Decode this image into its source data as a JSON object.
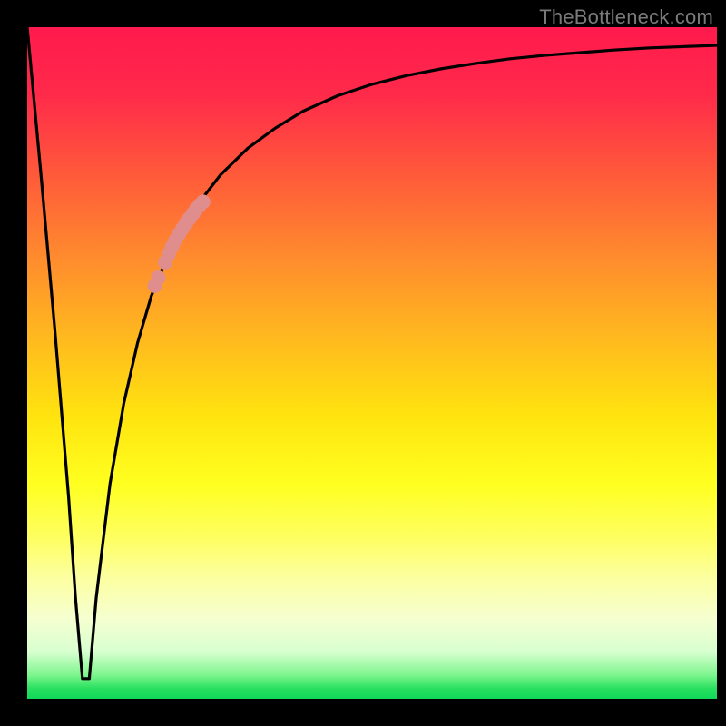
{
  "watermark": "TheBottleneck.com",
  "chart_data": {
    "type": "line",
    "title": "",
    "xlabel": "",
    "ylabel": "",
    "xlim": [
      0,
      100
    ],
    "ylim": [
      0,
      100
    ],
    "grid": false,
    "legend": false,
    "series": [
      {
        "name": "curve",
        "color": "#000000",
        "x": [
          0,
          2,
          4,
          6,
          7,
          8,
          9,
          10,
          12,
          14,
          16,
          18,
          20,
          22,
          25,
          28,
          32,
          36,
          40,
          45,
          50,
          55,
          60,
          65,
          70,
          75,
          80,
          85,
          90,
          95,
          100
        ],
        "y": [
          100,
          78,
          55,
          30,
          15,
          3,
          3,
          15,
          32,
          44,
          53,
          60,
          65,
          69,
          74,
          78,
          82,
          85,
          87.5,
          89.8,
          91.5,
          92.8,
          93.8,
          94.6,
          95.3,
          95.8,
          96.2,
          96.6,
          96.9,
          97.1,
          97.3
        ]
      }
    ],
    "highlight": {
      "color": "#e08d8d",
      "points_xy": [
        [
          20,
          65.0
        ],
        [
          20.5,
          66.2
        ],
        [
          21,
          67.3
        ],
        [
          21.5,
          68.3
        ],
        [
          22,
          69.2
        ],
        [
          22.5,
          70.0
        ],
        [
          23,
          70.8
        ],
        [
          23.5,
          71.5
        ],
        [
          24,
          72.2
        ],
        [
          24.5,
          72.9
        ],
        [
          25,
          73.5
        ],
        [
          25.5,
          74.0
        ],
        [
          18.5,
          61.5
        ],
        [
          19,
          62.7
        ]
      ]
    }
  }
}
